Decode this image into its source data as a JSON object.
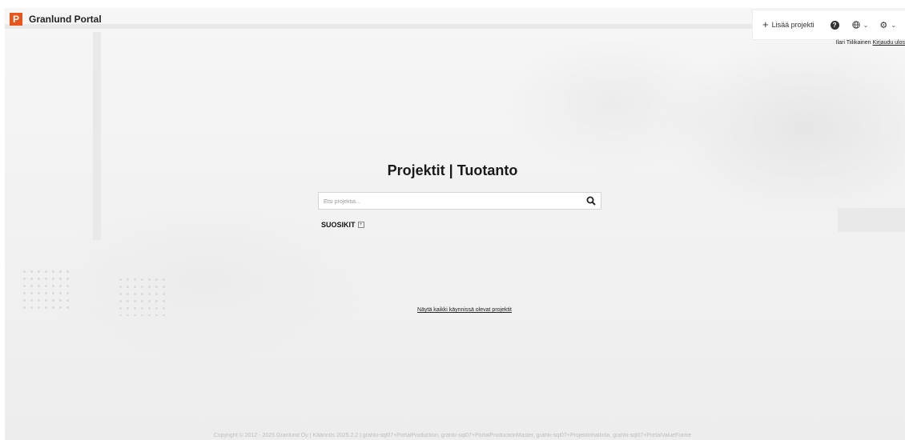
{
  "header": {
    "logo_letter": "P",
    "brand": "Granlund Portal",
    "add_project": "Lisää projekti",
    "help_glyph": "?",
    "user_name": "Ilari Tiilikainen",
    "logout": "Kirjaudu ulos"
  },
  "main": {
    "title": "Projektit | Tuotanto",
    "search_placeholder": "Etsi projektia...",
    "favorites_label": "SUOSIKIT",
    "show_all_link": "Näytä kaikki käynnissä olevat projektit"
  },
  "footer": {
    "text": "Copyright © 2012 - 2025 Granlund Oy | Käännös 2025.2.2 | grahki-sql07+PortalProduction, grahki-sql07+PortalProductionMaster, grahki-sql07+Projektinhallinta, grahki-sql07+PortalValueFrame"
  },
  "colors": {
    "brand": "#e8541b"
  },
  "icons": [
    "plus-icon",
    "help-icon",
    "globe-icon",
    "gear-icon",
    "chevron-down-icon",
    "search-icon",
    "expand-icon"
  ]
}
